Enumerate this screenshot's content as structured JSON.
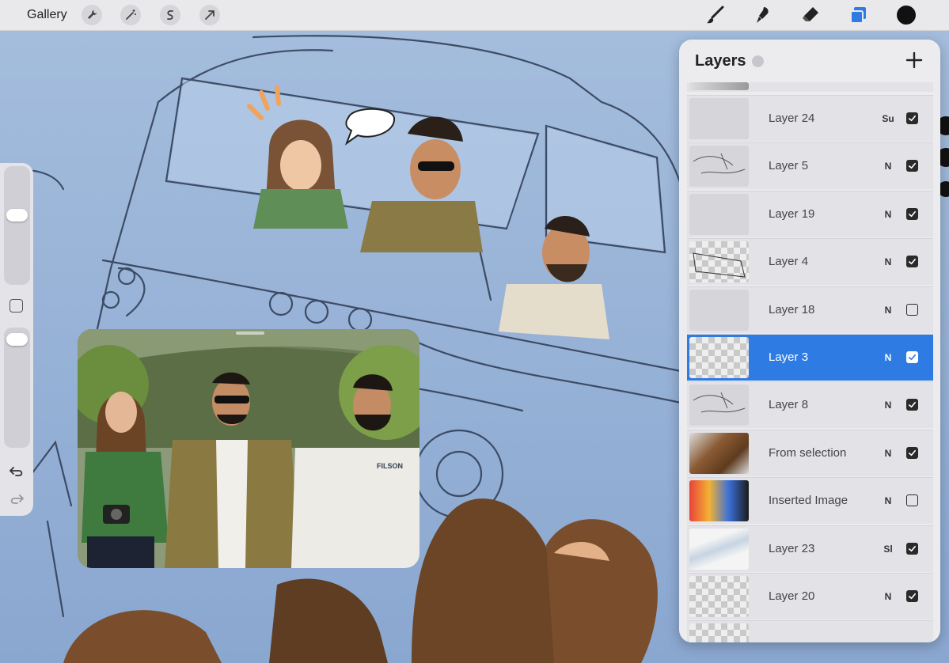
{
  "toolbar": {
    "gallery_label": "Gallery",
    "left_tools": [
      "wrench-icon",
      "magic-wand-icon",
      "selection-s-icon",
      "transform-arrow-icon"
    ],
    "right_tools": [
      "brush-icon",
      "smudge-icon",
      "eraser-icon",
      "layers-icon"
    ],
    "active_color": "#111111",
    "accent_color": "#2e7be4"
  },
  "sidebar": {
    "brush_size_level": 0.6,
    "opacity_level": 0.95
  },
  "layers_panel": {
    "title": "Layers",
    "layers": [
      {
        "name": "Layer 24",
        "blend": "Su",
        "visible": true,
        "selected": false,
        "thumb": "plain"
      },
      {
        "name": "Layer 5",
        "blend": "N",
        "visible": true,
        "selected": false,
        "thumb": "sketch"
      },
      {
        "name": "Layer 19",
        "blend": "N",
        "visible": true,
        "selected": false,
        "thumb": "plain"
      },
      {
        "name": "Layer 4",
        "blend": "N",
        "visible": true,
        "selected": false,
        "thumb": "checker-van"
      },
      {
        "name": "Layer 18",
        "blend": "N",
        "visible": false,
        "selected": false,
        "thumb": "plain"
      },
      {
        "name": "Layer 3",
        "blend": "N",
        "visible": true,
        "selected": true,
        "thumb": "checker"
      },
      {
        "name": "Layer 8",
        "blend": "N",
        "visible": true,
        "selected": false,
        "thumb": "sketch"
      },
      {
        "name": "From selection",
        "blend": "N",
        "visible": true,
        "selected": false,
        "thumb": "brown"
      },
      {
        "name": "Inserted Image",
        "blend": "N",
        "visible": false,
        "selected": false,
        "thumb": "colorful"
      },
      {
        "name": "Layer 23",
        "blend": "Sl",
        "visible": true,
        "selected": false,
        "thumb": "glass"
      },
      {
        "name": "Layer 20",
        "blend": "N",
        "visible": true,
        "selected": false,
        "thumb": "checker"
      }
    ]
  },
  "video_overlay": {
    "shirt_text": "FILSON"
  }
}
